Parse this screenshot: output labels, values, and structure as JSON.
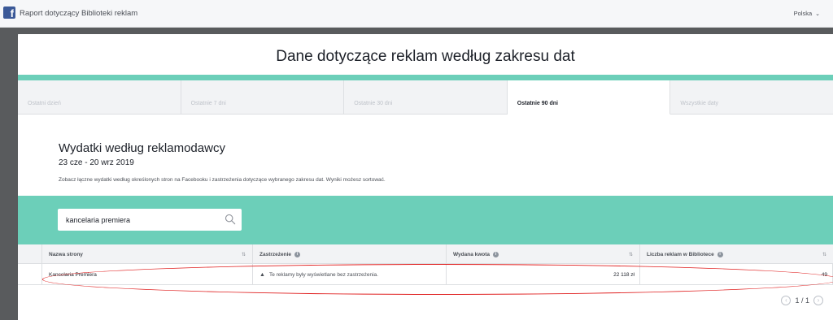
{
  "header": {
    "app_title": "Raport dotyczący Biblioteki reklam",
    "language": "Polska",
    "logo_letter": "f"
  },
  "main": {
    "title": "Dane dotyczące reklam według zakresu dat",
    "tabs": [
      {
        "label": "Ostatni dzień",
        "active": false
      },
      {
        "label": "Ostatnie 7 dni",
        "active": false
      },
      {
        "label": "Ostatnie 30 dni",
        "active": false
      },
      {
        "label": "Ostatnie 90 dni",
        "active": true
      },
      {
        "label": "Wszystkie daty",
        "active": false
      }
    ],
    "section_title": "Wydatki według reklamodawcy",
    "date_range": "23 cze - 20 wrz 2019",
    "description": "Zobacz łączne wydatki według określonych stron na Facebooku i zastrzeżenia dotyczące wybranego zakresu dat. Wyniki możesz sortować."
  },
  "search": {
    "value": "kancelaria premiera",
    "icon": "search-icon"
  },
  "table": {
    "columns": [
      {
        "label": "Nazwa strony"
      },
      {
        "label": "Zastrzeżenie"
      },
      {
        "label": "Wydana kwota"
      },
      {
        "label": "Liczba reklam w Bibliotece"
      }
    ],
    "rows": [
      {
        "page_name": "Kancelaria Premiera",
        "disclaimer": "Te reklamy były wyświetlane bez zastrzeżenia.",
        "amount": "22 118 zł",
        "ad_count": "49"
      }
    ]
  },
  "pagination": {
    "label": "1 / 1"
  },
  "colors": {
    "accent_teal": "#6ccfb9",
    "highlight_red": "#e02020",
    "facebook_blue": "#3b5998"
  }
}
